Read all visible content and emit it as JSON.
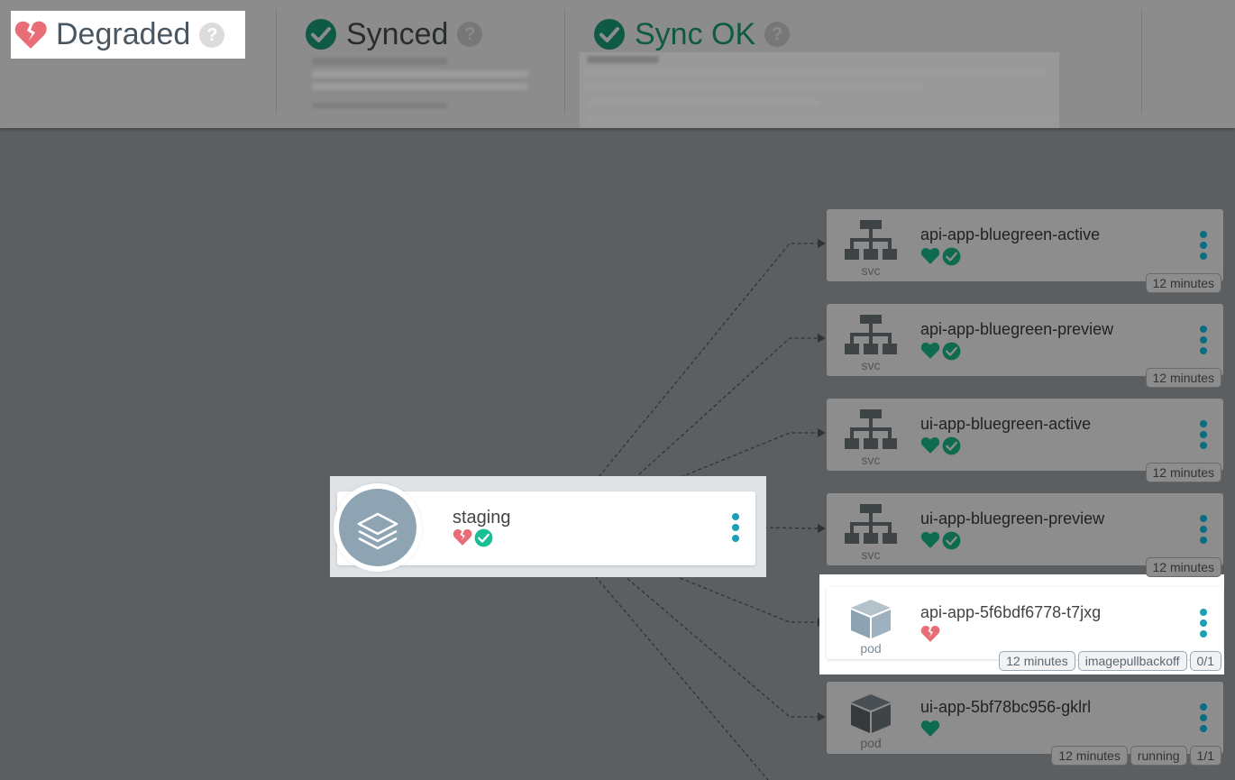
{
  "header": {
    "health": {
      "label": "Degraded",
      "icon": "broken-heart-icon",
      "help": "?"
    },
    "sync": {
      "label": "Synced",
      "icon": "check-circle-icon",
      "help": "?"
    },
    "operation": {
      "label": "Sync OK",
      "icon": "check-circle-icon",
      "help": "?"
    }
  },
  "app": {
    "name": "staging",
    "health": "degraded",
    "sync": "synced",
    "icon": "layers-icon"
  },
  "resources": [
    {
      "name": "api-app-bluegreen-active",
      "kind": "svc",
      "icon": "service-icon",
      "health": "healthy",
      "synced": true,
      "tags": [
        "12 minutes"
      ]
    },
    {
      "name": "api-app-bluegreen-preview",
      "kind": "svc",
      "icon": "service-icon",
      "health": "healthy",
      "synced": true,
      "tags": [
        "12 minutes"
      ]
    },
    {
      "name": "ui-app-bluegreen-active",
      "kind": "svc",
      "icon": "service-icon",
      "health": "healthy",
      "synced": true,
      "tags": [
        "12 minutes"
      ]
    },
    {
      "name": "ui-app-bluegreen-preview",
      "kind": "svc",
      "icon": "service-icon",
      "health": "healthy",
      "synced": true,
      "tags": [
        "12 minutes"
      ]
    },
    {
      "name": "api-app-5f6bdf6778-t7jxg",
      "kind": "pod",
      "icon": "cube-icon",
      "health": "degraded",
      "synced": false,
      "tags": [
        "12 minutes",
        "imagepullbackoff",
        "0/1"
      ]
    },
    {
      "name": "ui-app-5bf78bc956-gklrl",
      "kind": "pod",
      "icon": "cube-icon",
      "health": "healthy",
      "synced": false,
      "tags": [
        "12 minutes",
        "running",
        "1/1"
      ]
    }
  ],
  "colors": {
    "healthy": "#0f6b4f",
    "healthy_bright": "#18be94",
    "degraded": "#e96d76",
    "accent": "#1aa0b8"
  }
}
